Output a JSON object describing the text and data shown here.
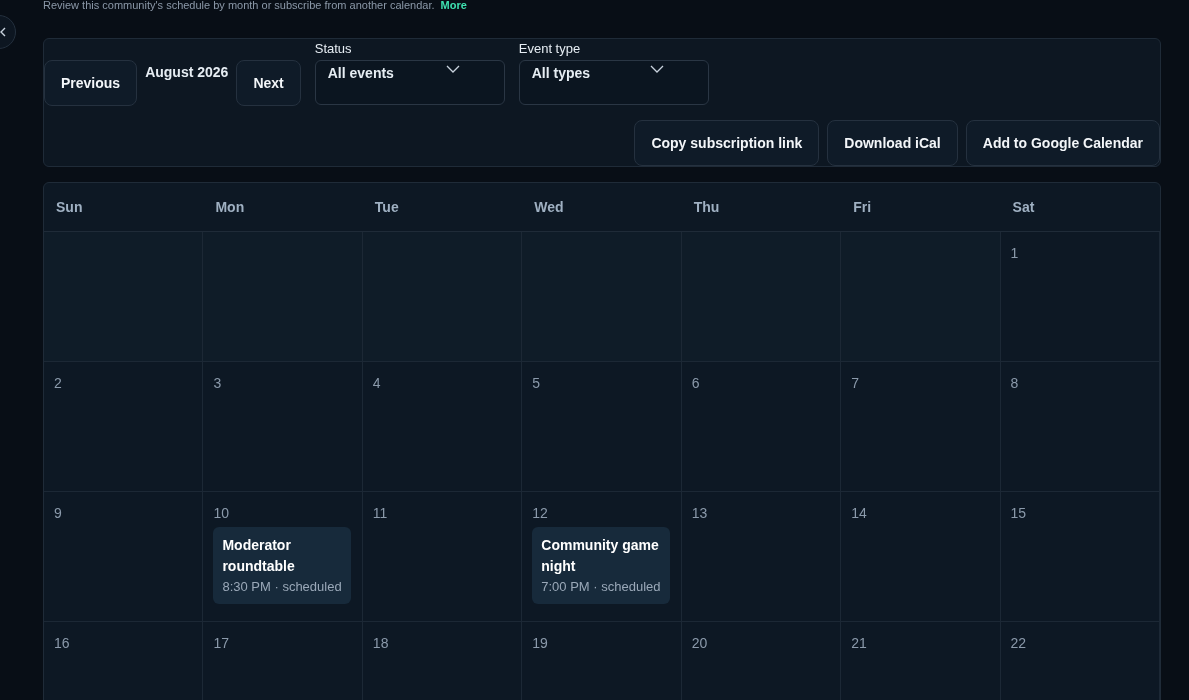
{
  "intro": {
    "text": "Review this community's schedule by month or subscribe from another calendar.",
    "link": "More"
  },
  "toolbar": {
    "previous": "Previous",
    "month": "August 2026",
    "next": "Next",
    "filters": [
      {
        "label": "Status",
        "value": "All events"
      },
      {
        "label": "Event type",
        "value": "All types"
      }
    ],
    "actions": [
      "Copy subscription link",
      "Download iCal",
      "Add to Google Calendar"
    ]
  },
  "calendar": {
    "weekdays": [
      "Sun",
      "Mon",
      "Tue",
      "Wed",
      "Thu",
      "Fri",
      "Sat"
    ],
    "weeks": [
      [
        {
          "kind": "blank"
        },
        {
          "kind": "blank"
        },
        {
          "kind": "blank"
        },
        {
          "kind": "blank"
        },
        {
          "kind": "blank"
        },
        {
          "kind": "blank"
        },
        {
          "kind": "day",
          "day": "1"
        }
      ],
      [
        {
          "kind": "day",
          "day": "2"
        },
        {
          "kind": "day",
          "day": "3"
        },
        {
          "kind": "day",
          "day": "4"
        },
        {
          "kind": "day",
          "day": "5"
        },
        {
          "kind": "day",
          "day": "6"
        },
        {
          "kind": "day",
          "day": "7"
        },
        {
          "kind": "day",
          "day": "8"
        }
      ],
      [
        {
          "kind": "day",
          "day": "9"
        },
        {
          "kind": "day",
          "day": "10",
          "events": [
            {
              "title": "Moderator roundtable",
              "meta": "8:30 PM · scheduled"
            }
          ]
        },
        {
          "kind": "day",
          "day": "11"
        },
        {
          "kind": "day",
          "day": "12",
          "events": [
            {
              "title": "Community game night",
              "meta": "7:00 PM · scheduled"
            }
          ]
        },
        {
          "kind": "day",
          "day": "13"
        },
        {
          "kind": "day",
          "day": "14"
        },
        {
          "kind": "day",
          "day": "15"
        }
      ],
      [
        {
          "kind": "day",
          "day": "16"
        },
        {
          "kind": "day",
          "day": "17"
        },
        {
          "kind": "day",
          "day": "18"
        },
        {
          "kind": "day",
          "day": "19"
        },
        {
          "kind": "day",
          "day": "20"
        },
        {
          "kind": "day",
          "day": "21"
        },
        {
          "kind": "day",
          "day": "22"
        }
      ]
    ]
  }
}
